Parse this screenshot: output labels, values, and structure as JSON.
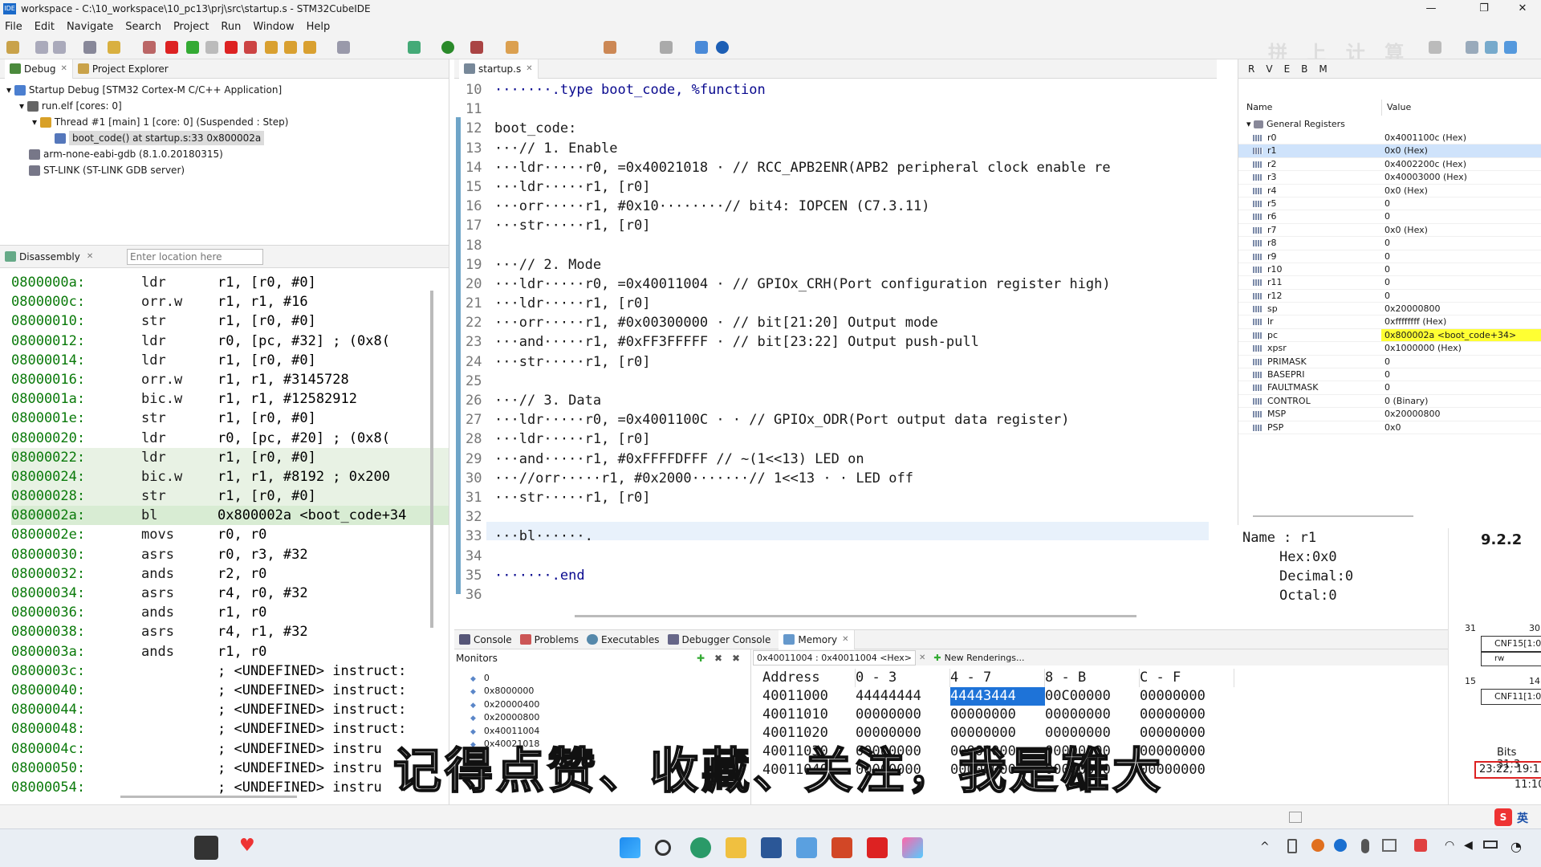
{
  "window": {
    "title": "workspace - C:\\10_workspace\\10_pc13\\prj\\src\\startup.s - STM32CubeIDE",
    "icon_label": "IDE",
    "controls": [
      "—",
      "❐",
      "✕"
    ]
  },
  "menu": [
    "File",
    "Edit",
    "Navigate",
    "Search",
    "Project",
    "Run",
    "Window",
    "Help"
  ],
  "debug_panel": {
    "tabs": [
      "Debug",
      "Project Explorer"
    ],
    "tree": [
      {
        "label": "Startup Debug [STM32 Cortex-M C/C++ Application]"
      },
      {
        "label": "run.elf [cores: 0]"
      },
      {
        "label": "Thread #1 [main] 1 [core: 0] (Suspended : Step)"
      },
      {
        "label": "boot_code() at startup.s:33 0x800002a"
      },
      {
        "label": "arm-none-eabi-gdb (8.1.0.20180315)"
      },
      {
        "label": "ST-LINK (ST-LINK GDB server)"
      }
    ]
  },
  "disassembly": {
    "tab": "Disassembly",
    "location_placeholder": "Enter location here",
    "rows": [
      {
        "addr": "0800000a:",
        "ins": "ldr",
        "ops": "r1, [r0, #0]"
      },
      {
        "addr": "0800000c:",
        "ins": "orr.w",
        "ops": "r1, r1, #16"
      },
      {
        "addr": "08000010:",
        "ins": "str",
        "ops": "r1, [r0, #0]"
      },
      {
        "addr": "08000012:",
        "ins": "ldr",
        "ops": "r0, [pc, #32]   ; (0x8("
      },
      {
        "addr": "08000014:",
        "ins": "ldr",
        "ops": "r1, [r0, #0]"
      },
      {
        "addr": "08000016:",
        "ins": "orr.w",
        "ops": "r1, r1, #3145728"
      },
      {
        "addr": "0800001a:",
        "ins": "bic.w",
        "ops": "r1, r1, #12582912"
      },
      {
        "addr": "0800001e:",
        "ins": "str",
        "ops": "r1, [r0, #0]"
      },
      {
        "addr": "08000020:",
        "ins": "ldr",
        "ops": "r0, [pc, #20]   ; (0x8("
      },
      {
        "addr": "08000022:",
        "ins": "ldr",
        "ops": "r1, [r0, #0]"
      },
      {
        "addr": "08000024:",
        "ins": "bic.w",
        "ops": "r1, r1, #8192   ; 0x200"
      },
      {
        "addr": "08000028:",
        "ins": "str",
        "ops": "r1, [r0, #0]"
      },
      {
        "addr": "0800002a:",
        "ins": "bl",
        "ops": "0x800002a <boot_code+34"
      },
      {
        "addr": "0800002e:",
        "ins": "movs",
        "ops": "r0, r0"
      },
      {
        "addr": "08000030:",
        "ins": "asrs",
        "ops": "r0, r3, #32"
      },
      {
        "addr": "08000032:",
        "ins": "ands",
        "ops": "r2, r0"
      },
      {
        "addr": "08000034:",
        "ins": "asrs",
        "ops": "r4, r0, #32"
      },
      {
        "addr": "08000036:",
        "ins": "ands",
        "ops": "r1, r0"
      },
      {
        "addr": "08000038:",
        "ins": "asrs",
        "ops": "r4, r1, #32"
      },
      {
        "addr": "0800003a:",
        "ins": "ands",
        "ops": "r1, r0"
      },
      {
        "addr": "0800003c:",
        "ins": "",
        "ops": "; <UNDEFINED> instruct:"
      },
      {
        "addr": "08000040:",
        "ins": "",
        "ops": "; <UNDEFINED> instruct:"
      },
      {
        "addr": "08000044:",
        "ins": "",
        "ops": "; <UNDEFINED> instruct:"
      },
      {
        "addr": "08000048:",
        "ins": "",
        "ops": "; <UNDEFINED> instruct:"
      },
      {
        "addr": "0800004c:",
        "ins": "",
        "ops": "; <UNDEFINED> instru"
      },
      {
        "addr": "08000050:",
        "ins": "",
        "ops": "; <UNDEFINED> instru"
      },
      {
        "addr": "08000054:",
        "ins": "",
        "ops": "; <UNDEFINED> instru"
      }
    ]
  },
  "editor": {
    "tab": "startup.s",
    "lines": [
      {
        "n": "10",
        "t": "·······.type boot_code, %function"
      },
      {
        "n": "11",
        "t": ""
      },
      {
        "n": "12",
        "t": "boot_code:"
      },
      {
        "n": "13",
        "t": "···// 1. Enable"
      },
      {
        "n": "14",
        "t": "···ldr·····r0, =0x40021018 · // RCC_APB2ENR(APB2 peripheral clock enable re"
      },
      {
        "n": "15",
        "t": "···ldr·····r1, [r0]"
      },
      {
        "n": "16",
        "t": "···orr·····r1, #0x10········// bit4: IOPCEN (C7.3.11)"
      },
      {
        "n": "17",
        "t": "···str·····r1, [r0]"
      },
      {
        "n": "18",
        "t": ""
      },
      {
        "n": "19",
        "t": "···// 2. Mode"
      },
      {
        "n": "20",
        "t": "···ldr·····r0, =0x40011004 · // GPIOx_CRH(Port configuration register high)"
      },
      {
        "n": "21",
        "t": "···ldr·····r1, [r0]"
      },
      {
        "n": "22",
        "t": "···orr·····r1, #0x00300000 · // bit[21:20] Output mode"
      },
      {
        "n": "23",
        "t": "···and·····r1, #0xFF3FFFFF · // bit[23:22] Output push-pull"
      },
      {
        "n": "24",
        "t": "···str·····r1, [r0]"
      },
      {
        "n": "25",
        "t": ""
      },
      {
        "n": "26",
        "t": "···// 3. Data"
      },
      {
        "n": "27",
        "t": "···ldr·····r0, =0x4001100C · · // GPIOx_ODR(Port output data register)"
      },
      {
        "n": "28",
        "t": "···ldr·····r1, [r0]"
      },
      {
        "n": "29",
        "t": "···and·····r1, #0xFFFFDFFF // ~(1<<13) LED on"
      },
      {
        "n": "30",
        "t": "···//orr·····r1, #0x2000·······// 1<<13 · · LED off"
      },
      {
        "n": "31",
        "t": "···str·····r1, [r0]"
      },
      {
        "n": "32",
        "t": ""
      },
      {
        "n": "33",
        "t": "···bl······."
      },
      {
        "n": "34",
        "t": ""
      },
      {
        "n": "35",
        "t": "·······.end"
      },
      {
        "n": "36",
        "t": ""
      }
    ]
  },
  "registers": {
    "tab_labels": [
      "R",
      "V",
      "E",
      "B",
      "M"
    ],
    "col_name": "Name",
    "col_value": "Value",
    "group": "General Registers",
    "rows": [
      {
        "n": "r0",
        "v": "0x4001100c (Hex)"
      },
      {
        "n": "r1",
        "v": "0x0 (Hex)"
      },
      {
        "n": "r2",
        "v": "0x4002200c (Hex)"
      },
      {
        "n": "r3",
        "v": "0x40003000 (Hex)"
      },
      {
        "n": "r4",
        "v": "0x0 (Hex)"
      },
      {
        "n": "r5",
        "v": "0"
      },
      {
        "n": "r6",
        "v": "0"
      },
      {
        "n": "r7",
        "v": "0x0 (Hex)"
      },
      {
        "n": "r8",
        "v": "0"
      },
      {
        "n": "r9",
        "v": "0"
      },
      {
        "n": "r10",
        "v": "0"
      },
      {
        "n": "r11",
        "v": "0"
      },
      {
        "n": "r12",
        "v": "0"
      },
      {
        "n": "sp",
        "v": "0x20000800"
      },
      {
        "n": "lr",
        "v": "0xffffffff (Hex)"
      },
      {
        "n": "pc",
        "v": "0x800002a <boot_code+34>"
      },
      {
        "n": "xpsr",
        "v": "0x1000000 (Hex)"
      },
      {
        "n": "PRIMASK",
        "v": "0"
      },
      {
        "n": "BASEPRI",
        "v": "0"
      },
      {
        "n": "FAULTMASK",
        "v": "0"
      },
      {
        "n": "CONTROL",
        "v": "0 (Binary)"
      },
      {
        "n": "MSP",
        "v": "0x20000800"
      },
      {
        "n": "PSP",
        "v": "0x0"
      }
    ],
    "detail": [
      "Name : r1",
      "Hex:0x0",
      "Decimal:0",
      "Octal:0"
    ]
  },
  "doc_overlay": {
    "section": "9.2.2",
    "bit_hi": "31",
    "bit_hi2": "30",
    "cnf15": "CNF15[1:0]",
    "rw": "rw",
    "bit15": "15",
    "bit14": "14",
    "cnf11": "CNF11[1:0]",
    "bits_label": "Bits 31:3",
    "bits_box": "23:22, 19:1",
    "bits_tail": "11:10"
  },
  "bottom": {
    "tabs": [
      "Console",
      "Problems",
      "Executables",
      "Debugger Console",
      "Memory"
    ],
    "monitors_label": "Monitors",
    "monitors": [
      "0",
      "0x8000000",
      "0x20000400",
      "0x20000800",
      "0x40011004",
      "0x40021018"
    ],
    "rendering_tab": "0x40011004 : 0x40011004 <Hex>",
    "new_renderings": "New Renderings...",
    "mem_headers": [
      "Address",
      "0 - 3",
      "4 - 7",
      "8 - B",
      "C - F"
    ],
    "mem_rows": [
      [
        "40011000",
        "44444444",
        "44443444",
        "00C00000",
        "00000000"
      ],
      [
        "40011010",
        "00000000",
        "00000000",
        "00000000",
        "00000000"
      ],
      [
        "40011020",
        "00000000",
        "00000000",
        "00000000",
        "00000000"
      ],
      [
        "40011030",
        "00000000",
        "00000000",
        "00000000",
        "00000000"
      ],
      [
        "40011040",
        "00000000",
        "00000000",
        "00000000",
        "00000000"
      ]
    ]
  },
  "subtitle": "记得点赞、收藏、关注，我是雄大",
  "watermark": "拼 上 计 算",
  "ime": "英",
  "colors": {
    "pc_highlight": "#ffff33",
    "selection": "#cfe3fb",
    "mem_select": "#1e73d8",
    "address_green": "#0b7a0b"
  }
}
